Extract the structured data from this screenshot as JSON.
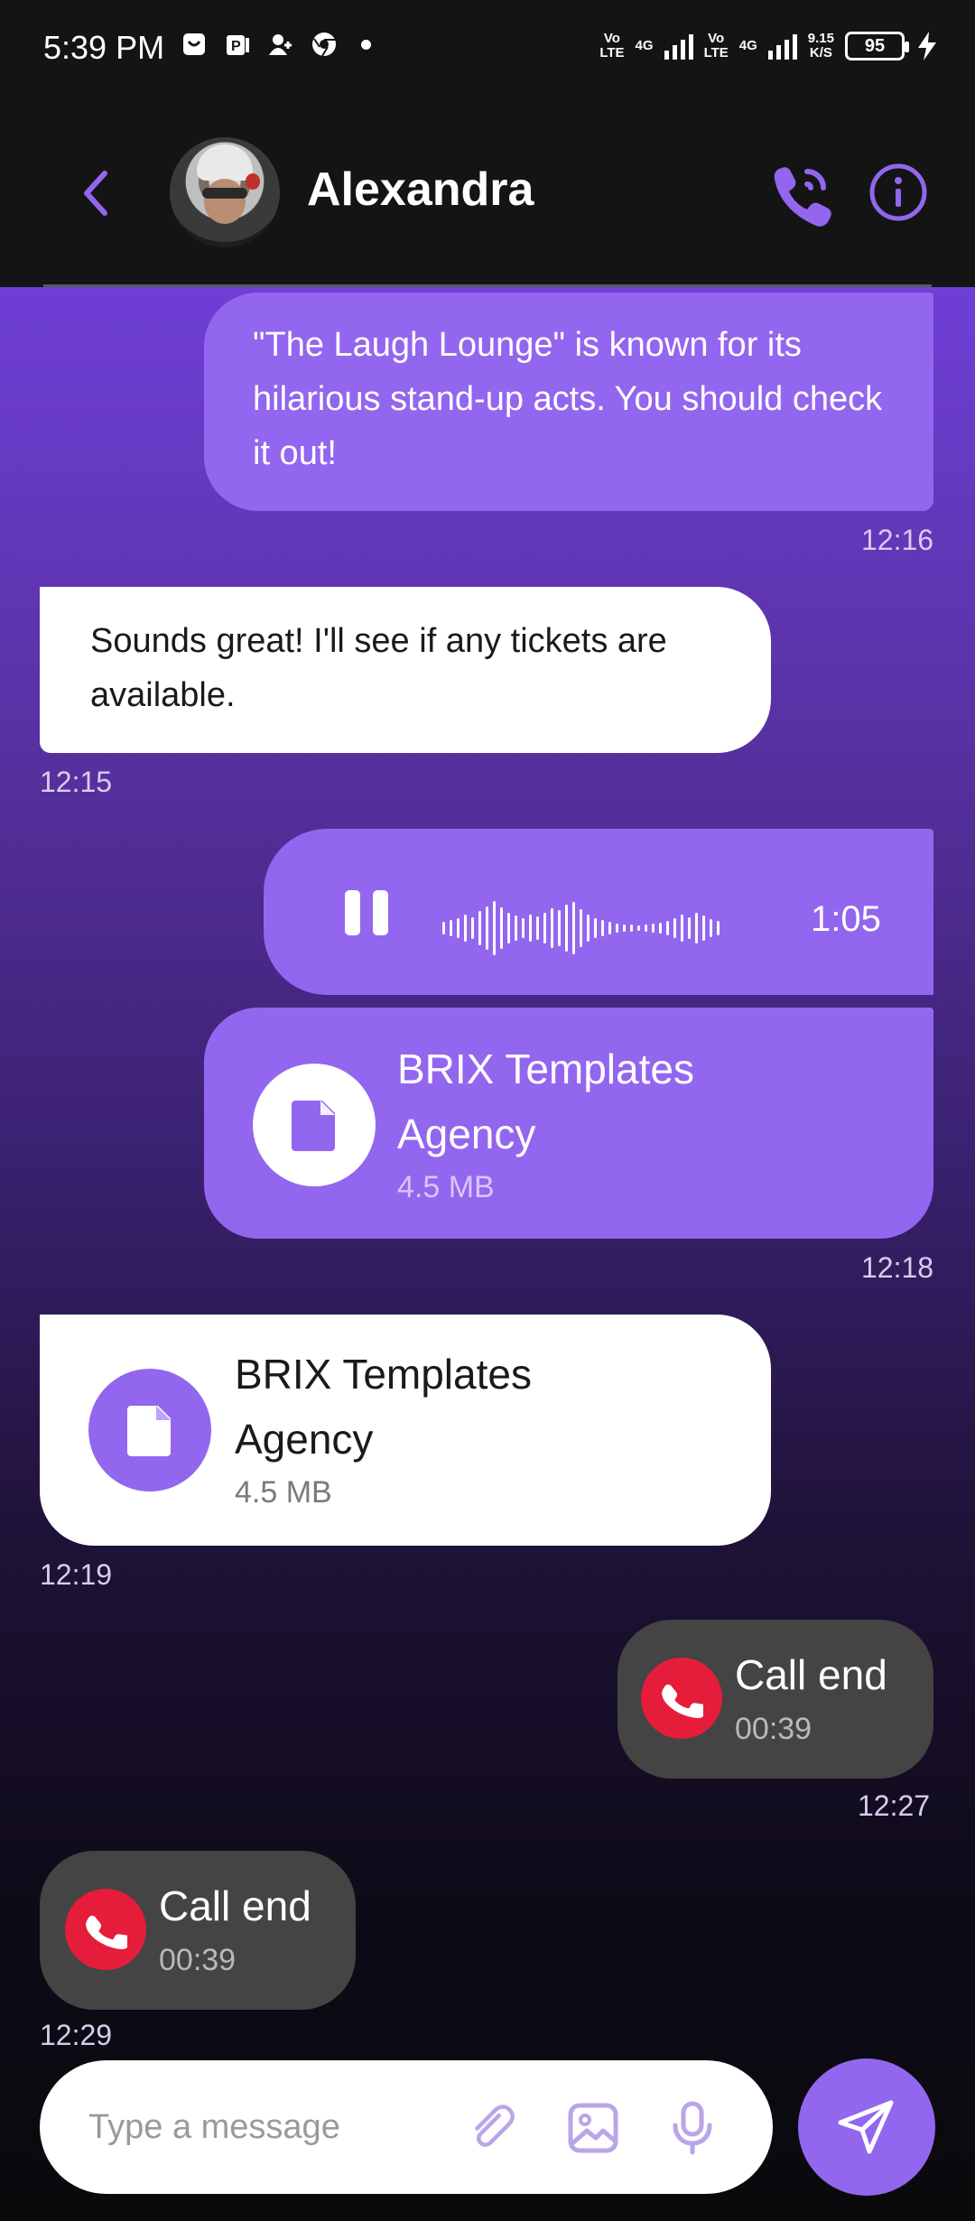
{
  "status_bar": {
    "time": "5:39 PM",
    "net1_top": "Vo",
    "net1_bottom": "LTE",
    "net1_type": "4G",
    "net2_top": "Vo",
    "net2_bottom": "LTE",
    "net2_type": "4G",
    "speed_top": "9.15",
    "speed_bottom": "K/S",
    "battery": "95"
  },
  "header": {
    "contact_name": "Alexandra"
  },
  "messages": [
    {
      "type": "text",
      "direction": "out",
      "text": "\"The Laugh Lounge\" is known for its hilarious stand-up acts. You should check it out!",
      "time": "12:16"
    },
    {
      "type": "text",
      "direction": "in",
      "text": "Sounds great! I'll see if any tickets are available.",
      "time": "12:15"
    },
    {
      "type": "voice",
      "direction": "out",
      "duration": "1:05"
    },
    {
      "type": "file",
      "direction": "out",
      "title": "BRIX Templates Agency",
      "size": "4.5 MB",
      "time": "12:18"
    },
    {
      "type": "file",
      "direction": "in",
      "title": "BRIX Templates Agency",
      "size": "4.5 MB",
      "time": "12:19"
    },
    {
      "type": "call",
      "direction": "out",
      "title": "Call end",
      "duration": "00:39",
      "time": "12:27"
    },
    {
      "type": "call",
      "direction": "in",
      "title": "Call end",
      "duration": "00:39",
      "time": "12:29"
    }
  ],
  "composer": {
    "placeholder": "Type a message"
  },
  "colors": {
    "accent": "#9366ef",
    "call_red": "#e51d3b",
    "header_bg": "#141414",
    "incoming_bg": "#ffffff"
  },
  "icons": [
    "back-arrow-icon",
    "phone-call-icon",
    "info-icon",
    "pause-icon",
    "file-icon",
    "phone-end-icon",
    "paperclip-icon",
    "image-icon",
    "microphone-icon",
    "send-icon"
  ]
}
